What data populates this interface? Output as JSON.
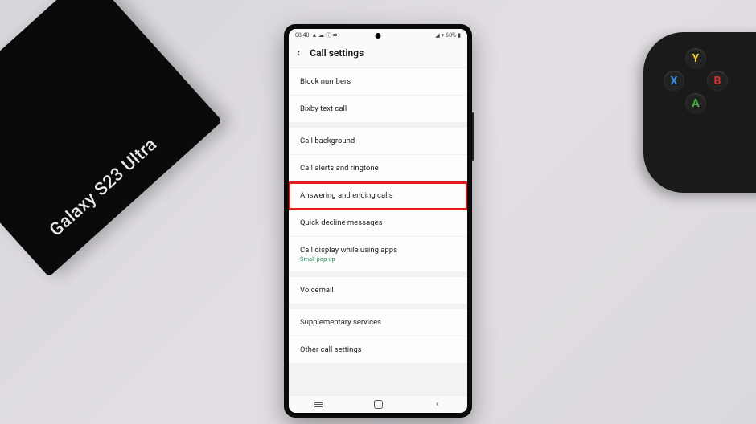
{
  "statusbar": {
    "time": "08:40",
    "icons_left": "▲ ☁ ⓘ ✱",
    "signal": "◢",
    "wifi": "▾",
    "battery_pct": "60%",
    "battery_icon": "▮"
  },
  "header": {
    "back_glyph": "‹",
    "title": "Call settings"
  },
  "groups": [
    {
      "items": [
        {
          "label": "Block numbers"
        },
        {
          "label": "Bixby text call"
        }
      ]
    },
    {
      "items": [
        {
          "label": "Call background"
        },
        {
          "label": "Call alerts and ringtone"
        },
        {
          "label": "Answering and ending calls",
          "highlight": true
        },
        {
          "label": "Quick decline messages"
        },
        {
          "label": "Call display while using apps",
          "sub": "Small pop-up"
        }
      ]
    },
    {
      "items": [
        {
          "label": "Voicemail"
        }
      ]
    },
    {
      "items": [
        {
          "label": "Supplementary services"
        },
        {
          "label": "Other call settings"
        }
      ]
    }
  ],
  "scene": {
    "box_brand": "Galaxy S23 Ultra",
    "controller_buttons": {
      "y": "Y",
      "x": "X",
      "b": "B",
      "a": "A"
    }
  }
}
